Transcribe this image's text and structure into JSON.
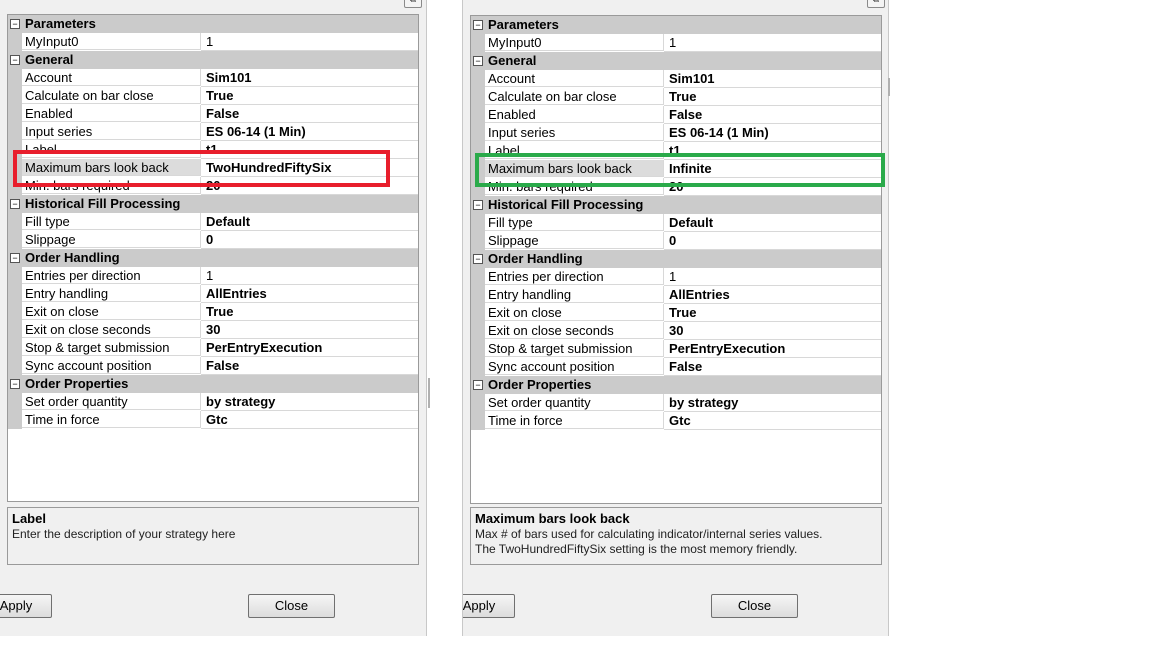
{
  "panels": [
    {
      "id": "left",
      "categories": [
        {
          "label": "Parameters",
          "rows": [
            {
              "name": "MyInput0",
              "value": "1",
              "plain": true
            }
          ]
        },
        {
          "label": "General",
          "rows": [
            {
              "name": "Account",
              "value": "Sim101"
            },
            {
              "name": "Calculate on bar close",
              "value": "True"
            },
            {
              "name": "Enabled",
              "value": "False"
            },
            {
              "name": "Input series",
              "value": "ES 06-14 (1 Min)"
            },
            {
              "name": "Label",
              "value": "t1"
            },
            {
              "name": "Maximum bars look back",
              "value": "TwoHundredFiftySix",
              "selected": true
            },
            {
              "name": "Min. bars required",
              "value": "20"
            }
          ]
        },
        {
          "label": "Historical Fill Processing",
          "rows": [
            {
              "name": "Fill type",
              "value": "Default"
            },
            {
              "name": "Slippage",
              "value": "0"
            }
          ]
        },
        {
          "label": "Order Handling",
          "rows": [
            {
              "name": "Entries per direction",
              "value": "1",
              "plain": true
            },
            {
              "name": "Entry handling",
              "value": "AllEntries"
            },
            {
              "name": "Exit on close",
              "value": "True"
            },
            {
              "name": "Exit on close seconds",
              "value": "30"
            },
            {
              "name": "Stop & target submission",
              "value": "PerEntryExecution"
            },
            {
              "name": "Sync account position",
              "value": "False"
            }
          ]
        },
        {
          "label": "Order Properties",
          "rows": [
            {
              "name": "Set order quantity",
              "value": "by strategy"
            },
            {
              "name": "Time in force",
              "value": "Gtc"
            }
          ]
        }
      ],
      "description": {
        "title": "Label",
        "lines": [
          "Enter the description of your strategy here"
        ]
      },
      "apply_label": "Apply",
      "close_label": "Close"
    },
    {
      "id": "right",
      "categories": [
        {
          "label": "Parameters",
          "rows": [
            {
              "name": "MyInput0",
              "value": "1",
              "plain": true
            }
          ]
        },
        {
          "label": "General",
          "rows": [
            {
              "name": "Account",
              "value": "Sim101"
            },
            {
              "name": "Calculate on bar close",
              "value": "True"
            },
            {
              "name": "Enabled",
              "value": "False"
            },
            {
              "name": "Input series",
              "value": "ES 06-14 (1 Min)"
            },
            {
              "name": "Label",
              "value": "t1"
            },
            {
              "name": "Maximum bars look back",
              "value": "Infinite",
              "selected": true
            },
            {
              "name": "Min. bars required",
              "value": "20"
            }
          ]
        },
        {
          "label": "Historical Fill Processing",
          "rows": [
            {
              "name": "Fill type",
              "value": "Default"
            },
            {
              "name": "Slippage",
              "value": "0"
            }
          ]
        },
        {
          "label": "Order Handling",
          "rows": [
            {
              "name": "Entries per direction",
              "value": "1",
              "plain": true
            },
            {
              "name": "Entry handling",
              "value": "AllEntries"
            },
            {
              "name": "Exit on close",
              "value": "True"
            },
            {
              "name": "Exit on close seconds",
              "value": "30"
            },
            {
              "name": "Stop & target submission",
              "value": "PerEntryExecution"
            },
            {
              "name": "Sync account position",
              "value": "False"
            }
          ]
        },
        {
          "label": "Order Properties",
          "rows": [
            {
              "name": "Set order quantity",
              "value": "by strategy"
            },
            {
              "name": "Time in force",
              "value": "Gtc"
            }
          ]
        }
      ],
      "description": {
        "title": "Maximum bars look back",
        "lines": [
          "Max # of bars used for calculating indicator/internal series values.",
          "The TwoHundredFiftySix setting is the most memory friendly."
        ]
      },
      "apply_label": "Apply",
      "close_label": "Close"
    }
  ],
  "highlights": {
    "left_color": "#e81e2c",
    "right_color": "#2aaa4a"
  },
  "icons": {
    "expander": "minus-box-icon",
    "window_corner": "restore-icon"
  }
}
